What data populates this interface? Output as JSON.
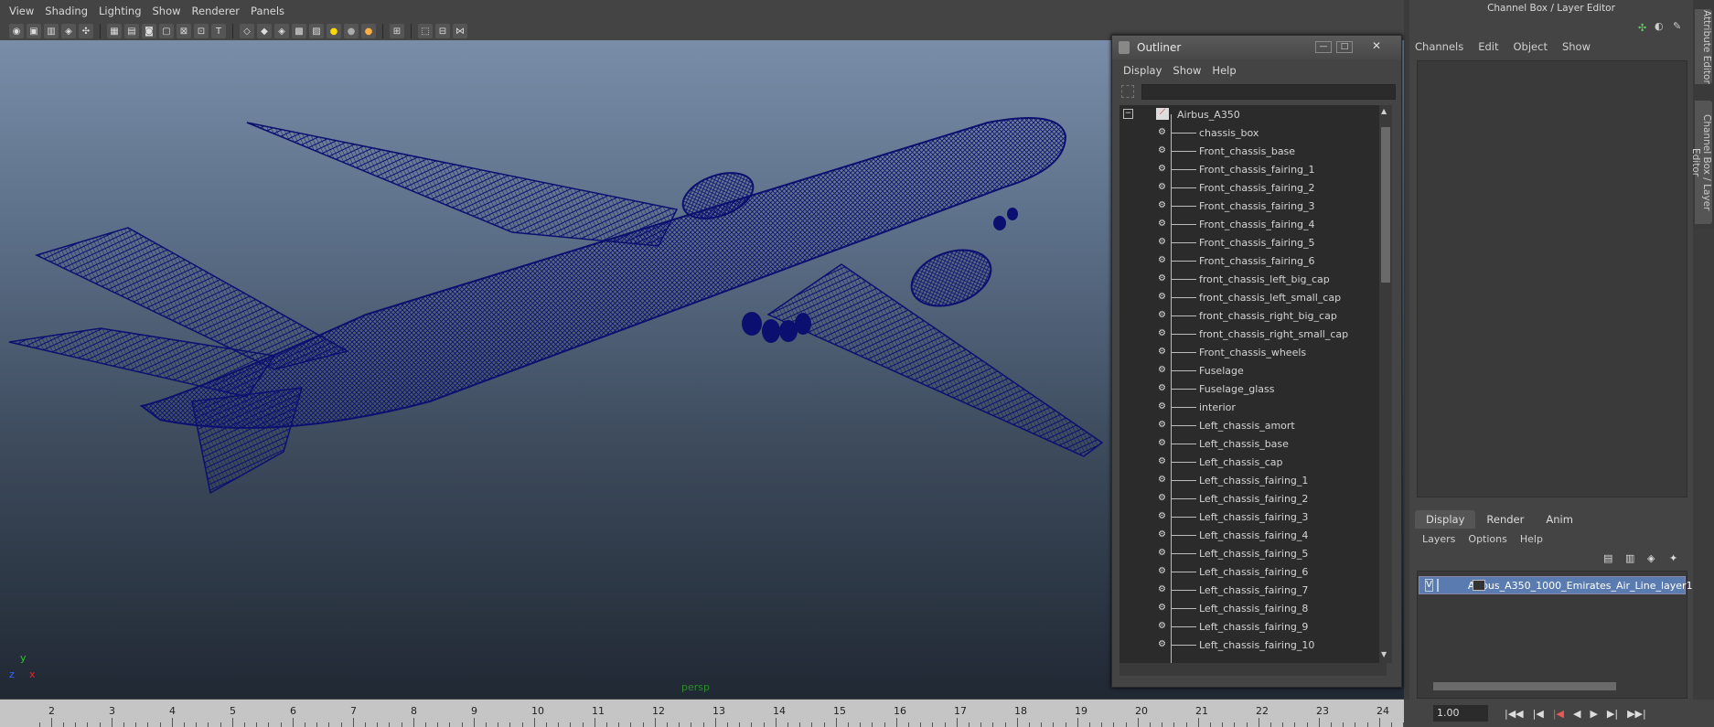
{
  "viewport": {
    "menu": [
      "View",
      "Shading",
      "Lighting",
      "Show",
      "Renderer",
      "Panels"
    ],
    "camera_label": "persp",
    "axes": {
      "x": "x",
      "y": "y",
      "z": "z"
    }
  },
  "outliner": {
    "title": "Outliner",
    "menu": [
      "Display",
      "Show",
      "Help"
    ],
    "filter_value": "",
    "root": "Airbus_A350",
    "items": [
      "chassis_box",
      "Front_chassis_base",
      "Front_chassis_fairing_1",
      "Front_chassis_fairing_2",
      "Front_chassis_fairing_3",
      "Front_chassis_fairing_4",
      "Front_chassis_fairing_5",
      "Front_chassis_fairing_6",
      "front_chassis_left_big_cap",
      "front_chassis_left_small_cap",
      "front_chassis_right_big_cap",
      "front_chassis_right_small_cap",
      "Front_chassis_wheels",
      "Fuselage",
      "Fuselage_glass",
      "interior",
      "Left_chassis_amort",
      "Left_chassis_base",
      "Left_chassis_cap",
      "Left_chassis_fairing_1",
      "Left_chassis_fairing_2",
      "Left_chassis_fairing_3",
      "Left_chassis_fairing_4",
      "Left_chassis_fairing_5",
      "Left_chassis_fairing_6",
      "Left_chassis_fairing_7",
      "Left_chassis_fairing_8",
      "Left_chassis_fairing_9",
      "Left_chassis_fairing_10"
    ]
  },
  "channel_box": {
    "title": "Channel Box / Layer Editor",
    "menu": [
      "Channels",
      "Edit",
      "Object",
      "Show"
    ],
    "tabs": [
      "Display",
      "Render",
      "Anim"
    ],
    "layer_menu": [
      "Layers",
      "Options",
      "Help"
    ],
    "layer": {
      "visible": "V",
      "name": "Airbus_A350_1000_Emirates_Air_Line_layer1"
    },
    "side_tabs": [
      "Attribute Editor",
      "Channel Box / Layer Editor"
    ]
  },
  "timeline": {
    "ticks": [
      "2",
      "3",
      "4",
      "5",
      "6",
      "7",
      "8",
      "9",
      "10",
      "11",
      "12",
      "13",
      "14",
      "15",
      "16",
      "17",
      "18",
      "19",
      "20",
      "21",
      "22",
      "23",
      "24"
    ],
    "current_frame": "1.00"
  },
  "colors": {
    "wire": "#0b1070",
    "accent": "#5a7bb0"
  }
}
